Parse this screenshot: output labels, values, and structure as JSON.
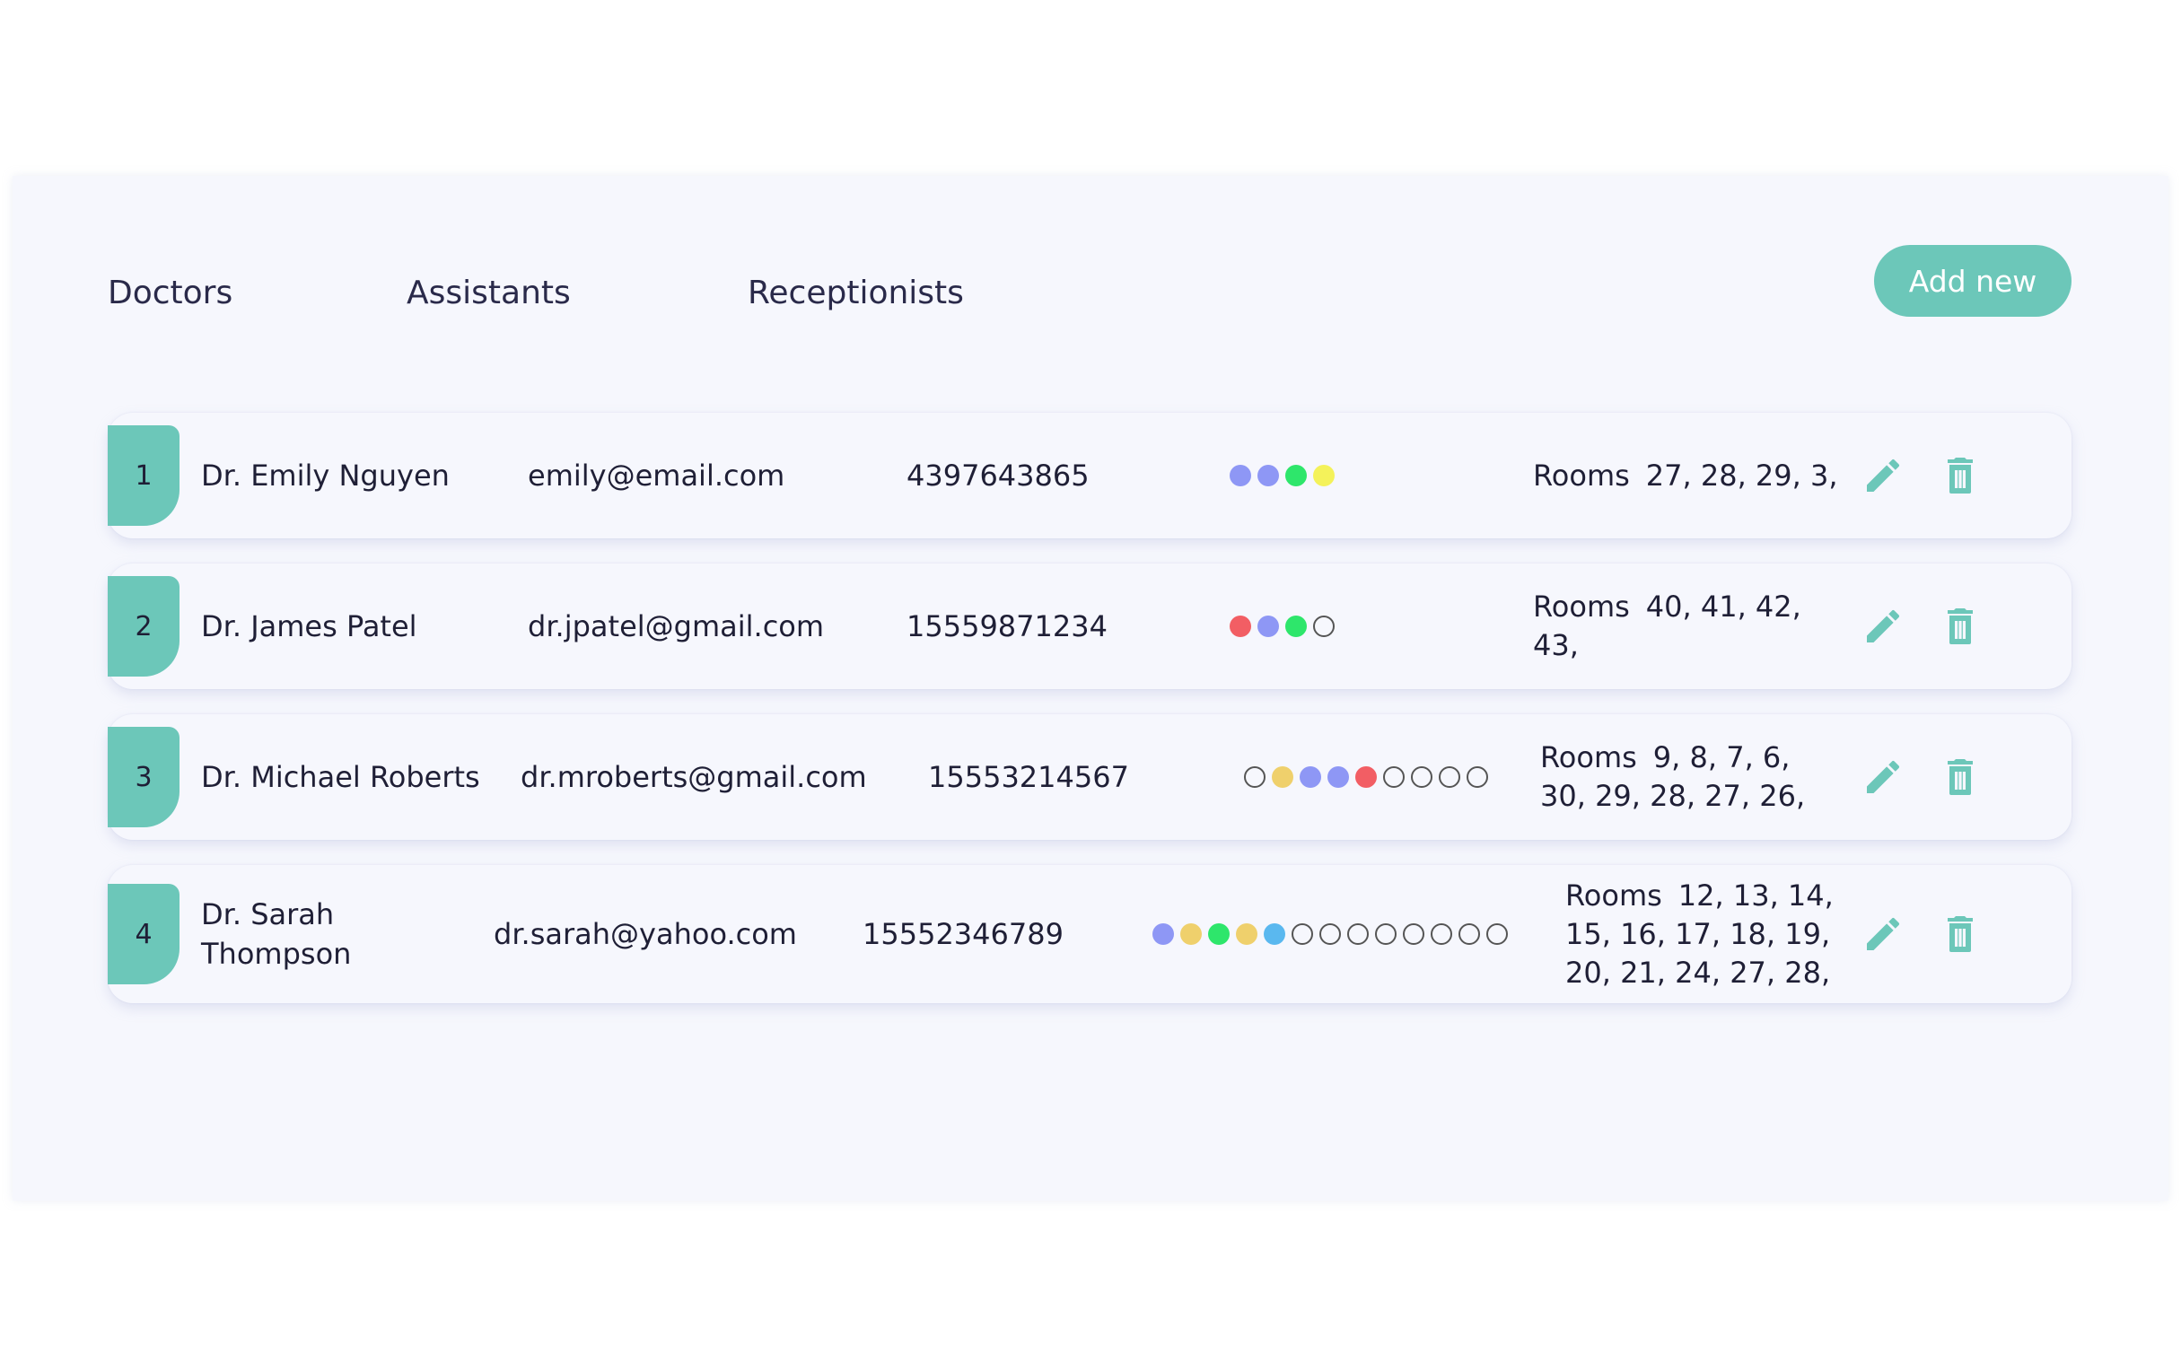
{
  "tabs": [
    {
      "label": "Doctors"
    },
    {
      "label": "Assistants"
    },
    {
      "label": "Receptionists"
    }
  ],
  "add_button": {
    "label": "Add new"
  },
  "colors": {
    "accent": "#6cc7b9",
    "panel": "#f6f7fd",
    "blue": "#8e97f5",
    "green": "#2ee66b",
    "yellow": "#f4f25a",
    "red": "#f25e64",
    "gold": "#efd06c",
    "sky": "#5ab8ef"
  },
  "rows": [
    {
      "index": "1",
      "name": "Dr. Emily Nguyen",
      "email": "emily@email.com",
      "phone": "4397643865",
      "dots": [
        "blue",
        "blue",
        "green",
        "yellow"
      ],
      "rooms_label": "Rooms",
      "rooms": "27, 28, 29, 3,"
    },
    {
      "index": "2",
      "name": "Dr. James Patel",
      "email": "dr.jpatel@gmail.com",
      "phone": "15559871234",
      "dots": [
        "red",
        "blue",
        "green",
        "empty"
      ],
      "rooms_label": "Rooms",
      "rooms": "40, 41, 42, 43,"
    },
    {
      "index": "3",
      "name": "Dr. Michael Roberts",
      "email": "dr.mroberts@gmail.com",
      "phone": "15553214567",
      "dots": [
        "empty",
        "gold",
        "blue",
        "blue",
        "red",
        "empty",
        "empty",
        "empty",
        "empty"
      ],
      "rooms_label": "Rooms",
      "rooms": "9, 8, 7, 6, 30, 29, 28, 27, 26,"
    },
    {
      "index": "4",
      "name": "Dr. Sarah Thompson",
      "email": "dr.sarah@yahoo.com",
      "phone": "15552346789",
      "dots": [
        "blue",
        "gold",
        "green",
        "gold",
        "sky",
        "empty",
        "empty",
        "empty",
        "empty",
        "empty",
        "empty",
        "empty",
        "empty"
      ],
      "rooms_label": "Rooms",
      "rooms": "12, 13, 14, 15, 16, 17, 18, 19, 20, 21, 24, 27, 28,"
    }
  ]
}
